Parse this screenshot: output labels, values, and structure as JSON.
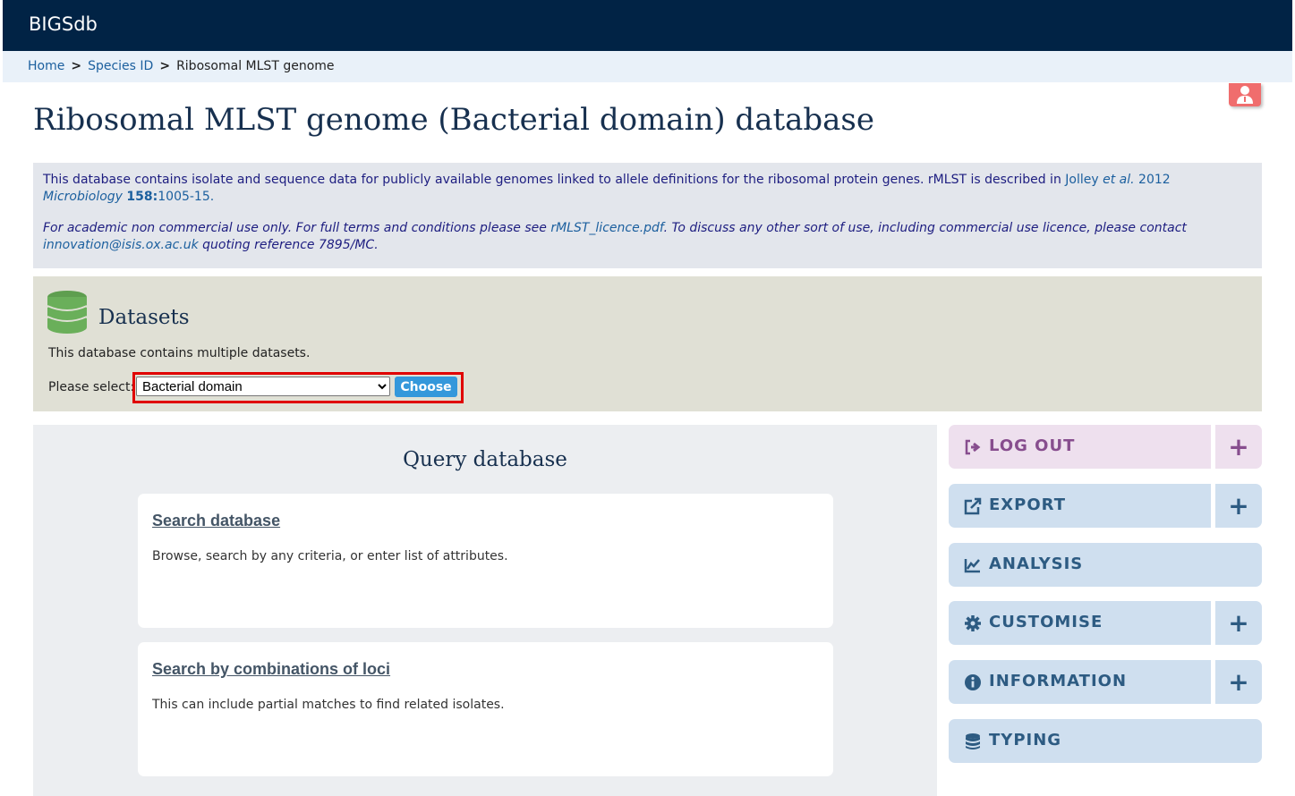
{
  "header": {
    "brand": "BIGSdb"
  },
  "breadcrumb": {
    "items": [
      {
        "label": "Home"
      },
      {
        "label": "Species ID"
      }
    ],
    "separator": ">",
    "current": "Ribosomal MLST genome"
  },
  "page_title": "Ribosomal MLST genome (Bacterial domain) database",
  "info": {
    "text1": "This database contains isolate and sequence data for publicly available genomes linked to allele definitions for the ribosomal protein genes. rMLST is described in ",
    "citation_author": "Jolley ",
    "citation_etal": "et al.",
    "citation_year": " 2012 ",
    "citation_journal": "Microbiology",
    "citation_volume": "158:",
    "citation_pages": "1005-15.",
    "licence_text1": "For academic non commercial use only. For full terms and conditions please see ",
    "licence_link": "rMLST_licence.pdf",
    "licence_text2": ". To discuss any other sort of use, including commercial use licence, please contact ",
    "contact_email": "innovation@isis.ox.ac.uk",
    "licence_text3": " quoting reference 7895/MC."
  },
  "datasets": {
    "title": "Datasets",
    "description": "This database contains multiple datasets.",
    "select_label": "Please select:",
    "selected": "Bacterial domain",
    "choose_label": "Choose"
  },
  "query": {
    "title": "Query database",
    "cards": [
      {
        "title": "Search database",
        "desc": "Browse, search by any criteria, or enter list of attributes."
      },
      {
        "title": "Search by combinations of loci",
        "desc": "This can include partial matches to find related isolates."
      }
    ]
  },
  "sidebar": {
    "buttons": [
      {
        "label": "LOG OUT",
        "icon": "sign-out-icon",
        "expand": "+"
      },
      {
        "label": "EXPORT",
        "icon": "external-link-icon",
        "expand": "+"
      },
      {
        "label": "ANALYSIS",
        "icon": "line-chart-icon"
      },
      {
        "label": "CUSTOMISE",
        "icon": "gear-icon",
        "expand": "+"
      },
      {
        "label": "INFORMATION",
        "icon": "info-circle-icon",
        "expand": "+"
      },
      {
        "label": "TYPING",
        "icon": "database-icon"
      }
    ]
  },
  "colors": {
    "header_bg": "#012345",
    "accent_blue": "#3498db",
    "highlight_red": "#e00000",
    "logout_pink": "#874d8e",
    "nav_blue": "#2d5b82"
  }
}
